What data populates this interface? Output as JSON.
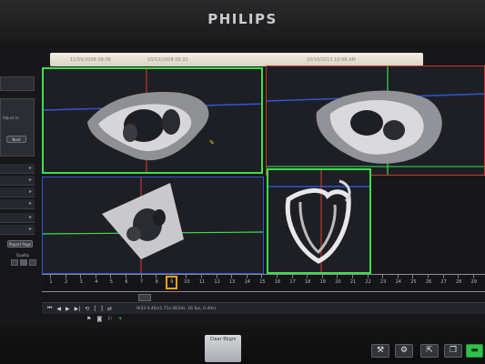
{
  "brand": "PHILIPS",
  "status_bar": {
    "left": "11/09/2008 08:06",
    "center": "10/12/2008 09:32",
    "right": "10/10/2013 10:08 AM"
  },
  "left_panel": {
    "caption": "Adjust to",
    "ok_label": "Next",
    "export_label": "Report Page",
    "quality_label": "Quality"
  },
  "timeline": {
    "frames": [
      "1",
      "2",
      "3",
      "4",
      "5",
      "6",
      "7",
      "8",
      "9",
      "10",
      "11",
      "12",
      "13",
      "14",
      "15",
      "16",
      "17",
      "18",
      "19",
      "20",
      "21",
      "22",
      "23",
      "24",
      "25",
      "26",
      "27",
      "28",
      "29"
    ],
    "current_frame": "9",
    "colors": {
      "marker": "#f3a21a",
      "green": "#39e14a",
      "red": "#c0392b",
      "blue": "#2f55d6"
    }
  },
  "toolbar": {
    "frame_info": "9/33  0.46s/1.71s  (8/34s, 16 fps, 0.40s)"
  },
  "bottom": {
    "card_label": "Clear Bkgrs"
  }
}
